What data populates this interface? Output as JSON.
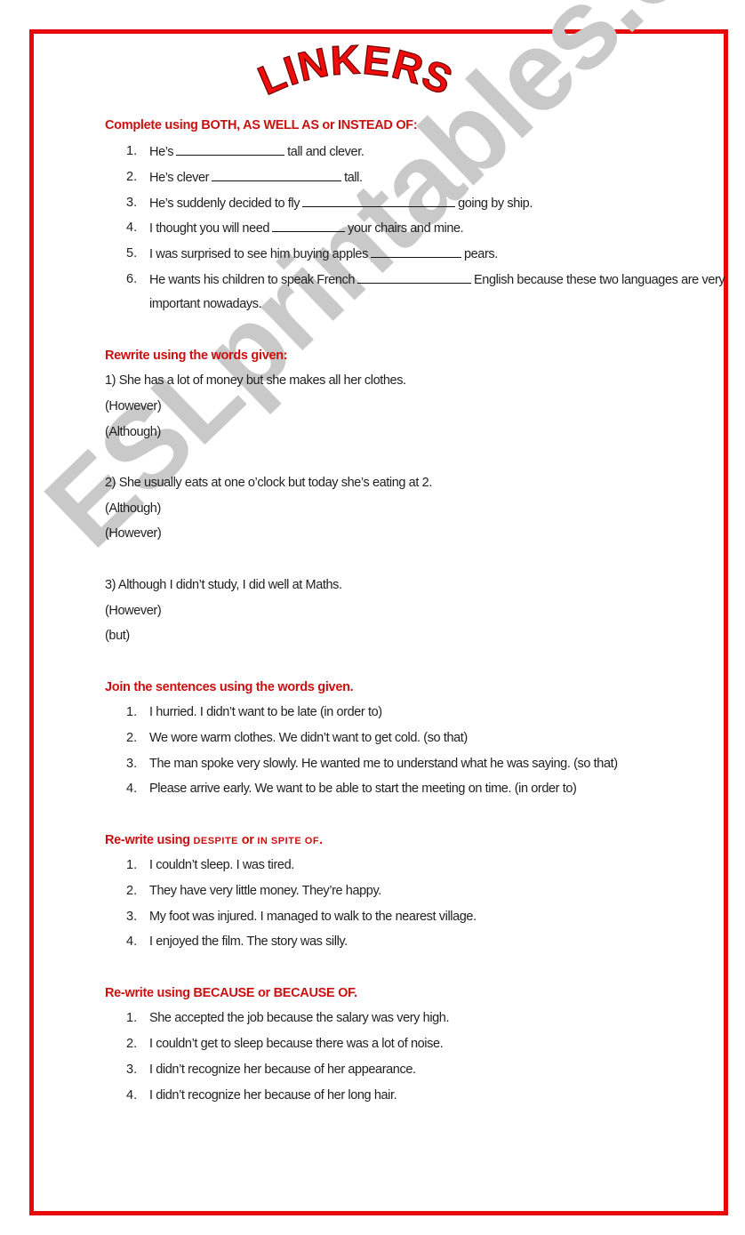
{
  "title": "LINKERS",
  "watermark": "ESLprintables.com",
  "colors": {
    "frame": "#e60a0a",
    "heading": "#cc1010",
    "title": "#f20d0d",
    "watermark": "#c9c9c9"
  },
  "sections": {
    "complete": {
      "heading": "Complete using BOTH, AS WELL AS or INSTEAD OF:",
      "items": [
        {
          "num": "1.",
          "before": "He’s",
          "after": "tall and clever."
        },
        {
          "num": "2.",
          "before": "He’s clever",
          "after": "tall."
        },
        {
          "num": "3.",
          "before": "He’s suddenly decided to fly",
          "after": "going by ship."
        },
        {
          "num": "4.",
          "before": "I thought you will need",
          "after": "your chairs and mine."
        },
        {
          "num": "5.",
          "before": "I was surprised to see him buying apples",
          "after": "pears."
        },
        {
          "num": "6.",
          "before": "He wants his children to speak French",
          "after": "English because these two languages are very",
          "continuation": "important nowadays."
        }
      ]
    },
    "rewrite": {
      "heading": "Rewrite using the words given:",
      "groups": [
        {
          "sentence": "1) She has a lot of money but she makes all her clothes.",
          "prompts": [
            "(However)",
            "(Although)"
          ]
        },
        {
          "sentence": "2) She usually eats at one o’clock but today she’s eating at 2.",
          "prompts": [
            "(Although)",
            "(However)"
          ]
        },
        {
          "sentence": "3) Although I didn’t study, I did well at Maths.",
          "prompts": [
            "(However)",
            "(but)"
          ]
        }
      ]
    },
    "join": {
      "heading": "Join the sentences using the words given.",
      "items": [
        {
          "num": "1.",
          "text": "I hurried. I didn’t want to be late (in order to)"
        },
        {
          "num": "2.",
          "text": "We wore warm clothes. We didn’t want to get cold. (so that)"
        },
        {
          "num": "3.",
          "text": "The man spoke very slowly. He wanted me to understand what he was saying. (so that)"
        },
        {
          "num": "4.",
          "text": "Please arrive early. We want to be able to start the meeting on time. (in order to)"
        }
      ]
    },
    "despite": {
      "heading_prefix": "Re-write using ",
      "heading_word1": "DESPITE",
      "heading_mid": " or ",
      "heading_word2": "IN SPITE OF",
      "heading_suffix": ".",
      "items": [
        {
          "num": "1.",
          "text": "I couldn’t sleep. I was tired."
        },
        {
          "num": "2.",
          "text": "They have very little money. They’re happy."
        },
        {
          "num": "3.",
          "text": "My foot was injured. I managed to walk to the nearest village."
        },
        {
          "num": "4.",
          "text": "I enjoyed the film. The story was silly."
        }
      ]
    },
    "because": {
      "heading": "Re-write using BECAUSE or BECAUSE OF.",
      "items": [
        {
          "num": "1.",
          "text": "She accepted the job because the salary was very high."
        },
        {
          "num": "2.",
          "text": "I couldn’t get to sleep because there was a lot of noise."
        },
        {
          "num": "3.",
          "text": "I didn’t recognize her because of her appearance."
        },
        {
          "num": "4.",
          "text": "I didn’t recognize her because of her long hair."
        }
      ]
    }
  }
}
